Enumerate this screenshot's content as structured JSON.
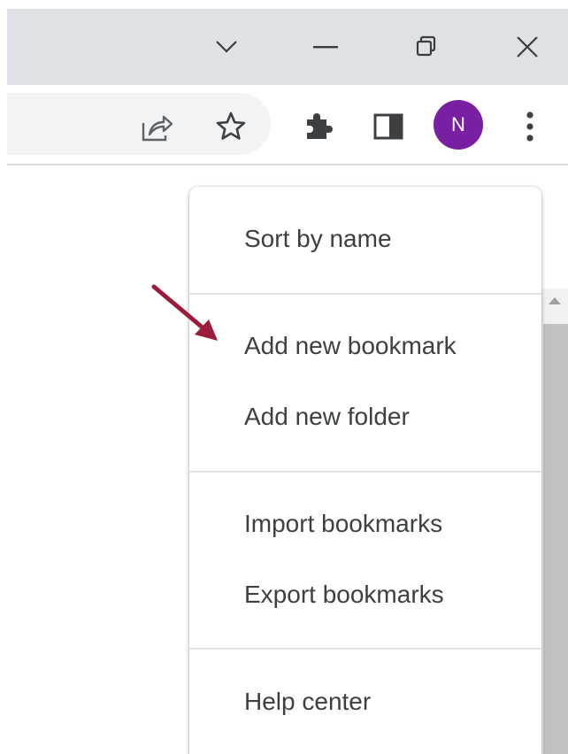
{
  "window": {
    "controls": [
      "chevron-down",
      "minimize",
      "restore",
      "close"
    ]
  },
  "toolbar": {
    "icons": [
      "share-icon",
      "bookmark-star-icon",
      "extensions-icon",
      "side-panel-icon",
      "more-vert-icon"
    ],
    "profile_initial": "N",
    "profile_color": "#7b1fa2"
  },
  "menu": {
    "sort_by_name": "Sort by name",
    "add_new_bookmark": "Add new bookmark",
    "add_new_folder": "Add new folder",
    "import_bookmarks": "Import bookmarks",
    "export_bookmarks": "Export bookmarks",
    "help_center": "Help center"
  },
  "annotation": {
    "arrow_color": "#9b1b3a",
    "points_to": "Add new bookmark"
  }
}
